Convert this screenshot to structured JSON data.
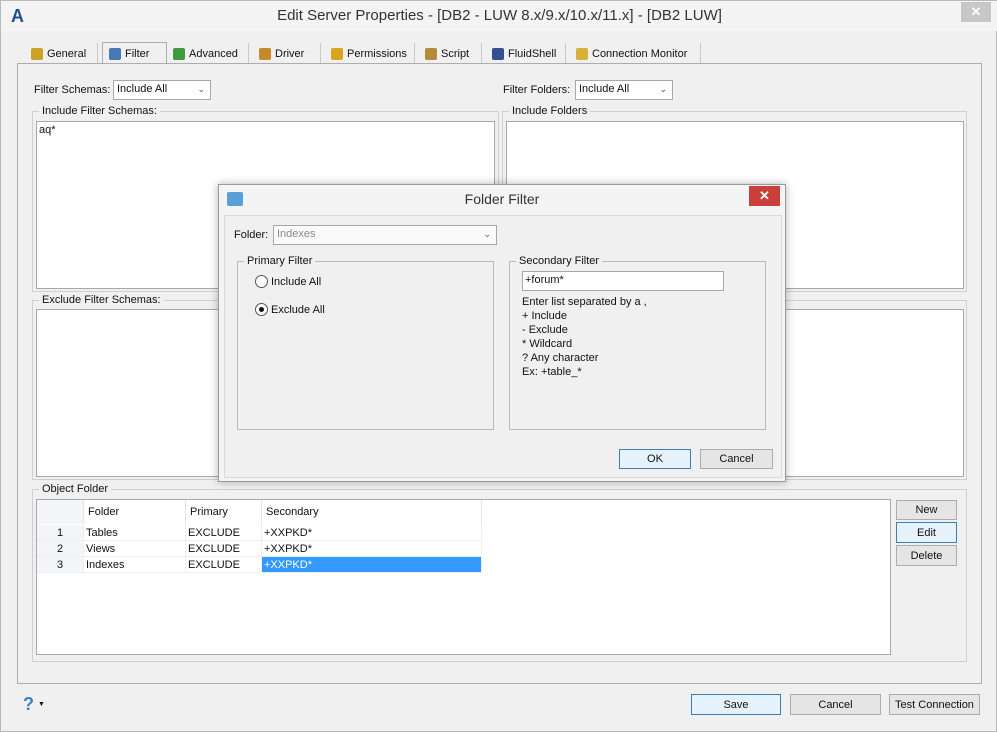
{
  "window": {
    "title": "Edit Server Properties - [DB2 - LUW 8.x/9.x/10.x/11.x] - [DB2 LUW]",
    "close": "✕",
    "app_logo": "A"
  },
  "tabs": [
    {
      "label": "General",
      "icon": "general-icon",
      "color": "#c9a227"
    },
    {
      "label": "Filter",
      "icon": "filter-icon",
      "color": "#4a78b5"
    },
    {
      "label": "Advanced",
      "icon": "advanced-icon",
      "color": "#3e9a3e"
    },
    {
      "label": "Driver",
      "icon": "driver-icon",
      "color": "#c58a2a"
    },
    {
      "label": "Permissions",
      "icon": "permissions-icon",
      "color": "#d9a520"
    },
    {
      "label": "Script",
      "icon": "script-icon",
      "color": "#b38b3a"
    },
    {
      "label": "FluidShell",
      "icon": "fluidshell-icon",
      "color": "#34508f"
    },
    {
      "label": "Connection Monitor",
      "icon": "connection-monitor-icon",
      "color": "#d6b23c"
    }
  ],
  "filter": {
    "schemas_label": "Filter Schemas:",
    "schemas_value": "Include All",
    "folders_label": "Filter Folders:",
    "folders_value": "Include All",
    "include_schemas_label": "Include Filter Schemas:",
    "include_schemas_value": "aq*",
    "include_folders_label": "Include Folders",
    "exclude_schemas_label": "Exclude Filter Schemas:",
    "object_folder_label": "Object Folder",
    "table": {
      "headers": [
        "",
        "Folder",
        "Primary",
        "Secondary"
      ],
      "rows": [
        [
          "1",
          "Tables",
          "EXCLUDE",
          "+XXPKD*"
        ],
        [
          "2",
          "Views",
          "EXCLUDE",
          "+XXPKD*"
        ],
        [
          "3",
          "Indexes",
          "EXCLUDE",
          "+XXPKD*"
        ]
      ],
      "selected_row": 3,
      "selection_color": "#3399ff"
    },
    "buttons": {
      "new": "New",
      "edit": "Edit",
      "delete": "Delete"
    }
  },
  "footer": {
    "help": "?",
    "save": "Save",
    "cancel": "Cancel",
    "test": "Test Connection"
  },
  "dialog": {
    "title": "Folder Filter",
    "close": "✕",
    "close_color": "#c9403a",
    "folder_label": "Folder:",
    "folder_value": "Indexes",
    "primary_label": "Primary Filter",
    "include_all": "Include All",
    "exclude_all": "Exclude All",
    "selected": "Exclude All",
    "secondary_label": "Secondary Filter",
    "secondary_value": "+forum*",
    "help_lines": [
      "Enter list separated by a ,",
      "+ Include",
      "- Exclude",
      "* Wildcard",
      "? Any character",
      "Ex: +table_*"
    ],
    "ok": "OK",
    "cancel": "Cancel"
  }
}
